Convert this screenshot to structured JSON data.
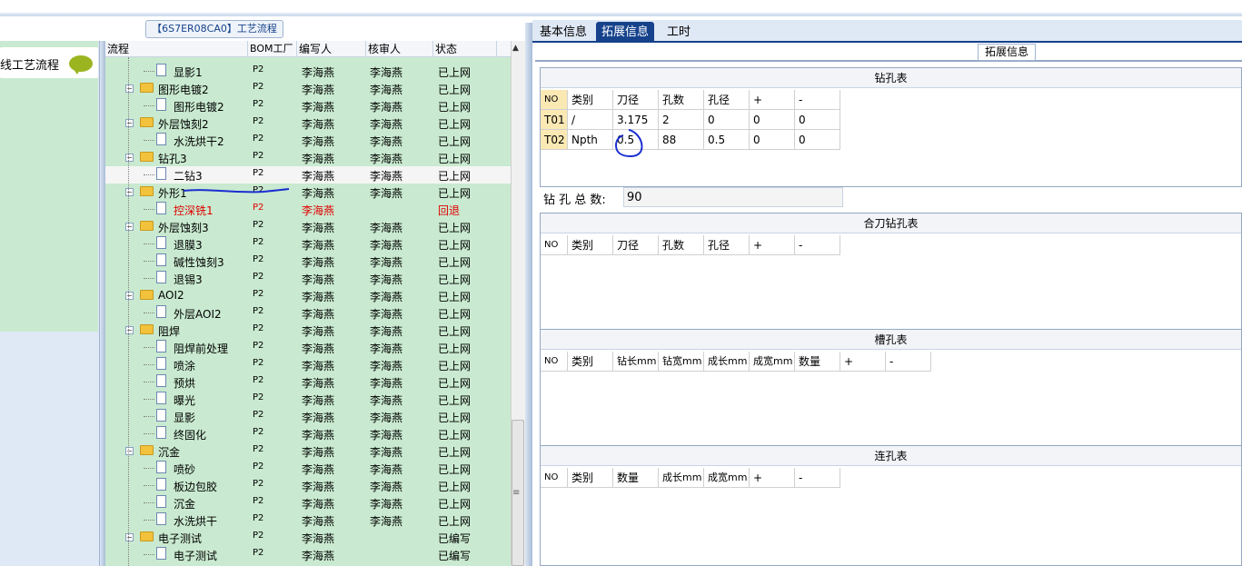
{
  "tree_title": "【6S7ER08CA0】工艺流程",
  "left_nav": {
    "item": "线工艺流程",
    "icon": "speech-bubble-icon"
  },
  "tree": {
    "columns": [
      "流程",
      "BOM工厂",
      "编写人",
      "核审人",
      "状态"
    ],
    "rows": [
      {
        "level": 2,
        "type": "doc",
        "name": "显影1",
        "bom": "P2",
        "writer": "李海燕",
        "reviewer": "李海燕",
        "status": "已上网"
      },
      {
        "level": 1,
        "type": "folder",
        "name": "图形电镀2",
        "bom": "P2",
        "writer": "李海燕",
        "reviewer": "李海燕",
        "status": "已上网"
      },
      {
        "level": 2,
        "type": "doc",
        "name": "图形电镀2",
        "bom": "P2",
        "writer": "李海燕",
        "reviewer": "李海燕",
        "status": "已上网"
      },
      {
        "level": 1,
        "type": "folder",
        "name": "外层蚀刻2",
        "bom": "P2",
        "writer": "李海燕",
        "reviewer": "李海燕",
        "status": "已上网"
      },
      {
        "level": 2,
        "type": "doc",
        "name": "水洗烘干2",
        "bom": "P2",
        "writer": "李海燕",
        "reviewer": "李海燕",
        "status": "已上网"
      },
      {
        "level": 1,
        "type": "folder",
        "name": "钻孔3",
        "bom": "P2",
        "writer": "李海燕",
        "reviewer": "李海燕",
        "status": "已上网"
      },
      {
        "level": 2,
        "type": "doc",
        "name": "二钻3",
        "bom": "P2",
        "writer": "李海燕",
        "reviewer": "李海燕",
        "status": "已上网",
        "selected": true
      },
      {
        "level": 1,
        "type": "folder",
        "name": "外形1",
        "bom": "P2",
        "writer": "李海燕",
        "reviewer": "李海燕",
        "status": "已上网"
      },
      {
        "level": 2,
        "type": "doc",
        "name": "控深铣1",
        "bom": "P2",
        "writer": "李海燕",
        "reviewer": "",
        "status": "回退",
        "red": true
      },
      {
        "level": 1,
        "type": "folder",
        "name": "外层蚀刻3",
        "bom": "P2",
        "writer": "李海燕",
        "reviewer": "李海燕",
        "status": "已上网"
      },
      {
        "level": 2,
        "type": "doc",
        "name": "退膜3",
        "bom": "P2",
        "writer": "李海燕",
        "reviewer": "李海燕",
        "status": "已上网"
      },
      {
        "level": 2,
        "type": "doc",
        "name": "碱性蚀刻3",
        "bom": "P2",
        "writer": "李海燕",
        "reviewer": "李海燕",
        "status": "已上网"
      },
      {
        "level": 2,
        "type": "doc",
        "name": "退锡3",
        "bom": "P2",
        "writer": "李海燕",
        "reviewer": "李海燕",
        "status": "已上网"
      },
      {
        "level": 1,
        "type": "folder",
        "name": "AOI2",
        "bom": "P2",
        "writer": "李海燕",
        "reviewer": "李海燕",
        "status": "已上网"
      },
      {
        "level": 2,
        "type": "doc",
        "name": "外层AOI2",
        "bom": "P2",
        "writer": "李海燕",
        "reviewer": "李海燕",
        "status": "已上网"
      },
      {
        "level": 1,
        "type": "folder",
        "name": "阻焊",
        "bom": "P2",
        "writer": "李海燕",
        "reviewer": "李海燕",
        "status": "已上网"
      },
      {
        "level": 2,
        "type": "doc",
        "name": "阻焊前处理",
        "bom": "P2",
        "writer": "李海燕",
        "reviewer": "李海燕",
        "status": "已上网"
      },
      {
        "level": 2,
        "type": "doc",
        "name": "喷涂",
        "bom": "P2",
        "writer": "李海燕",
        "reviewer": "李海燕",
        "status": "已上网"
      },
      {
        "level": 2,
        "type": "doc",
        "name": "预烘",
        "bom": "P2",
        "writer": "李海燕",
        "reviewer": "李海燕",
        "status": "已上网"
      },
      {
        "level": 2,
        "type": "doc",
        "name": "曝光",
        "bom": "P2",
        "writer": "李海燕",
        "reviewer": "李海燕",
        "status": "已上网"
      },
      {
        "level": 2,
        "type": "doc",
        "name": "显影",
        "bom": "P2",
        "writer": "李海燕",
        "reviewer": "李海燕",
        "status": "已上网"
      },
      {
        "level": 2,
        "type": "doc",
        "name": "终固化",
        "bom": "P2",
        "writer": "李海燕",
        "reviewer": "李海燕",
        "status": "已上网"
      },
      {
        "level": 1,
        "type": "folder",
        "name": "沉金",
        "bom": "P2",
        "writer": "李海燕",
        "reviewer": "李海燕",
        "status": "已上网"
      },
      {
        "level": 2,
        "type": "doc",
        "name": "喷砂",
        "bom": "P2",
        "writer": "李海燕",
        "reviewer": "李海燕",
        "status": "已上网"
      },
      {
        "level": 2,
        "type": "doc",
        "name": "板边包胶",
        "bom": "P2",
        "writer": "李海燕",
        "reviewer": "李海燕",
        "status": "已上网"
      },
      {
        "level": 2,
        "type": "doc",
        "name": "沉金",
        "bom": "P2",
        "writer": "李海燕",
        "reviewer": "李海燕",
        "status": "已上网"
      },
      {
        "level": 2,
        "type": "doc",
        "name": "水洗烘干",
        "bom": "P2",
        "writer": "李海燕",
        "reviewer": "李海燕",
        "status": "已上网"
      },
      {
        "level": 1,
        "type": "folder",
        "name": "电子测试",
        "bom": "P2",
        "writer": "李海燕",
        "reviewer": "",
        "status": "已编写"
      },
      {
        "level": 2,
        "type": "doc",
        "name": "电子测试",
        "bom": "P2",
        "writer": "李海燕",
        "reviewer": "",
        "status": "已编写"
      }
    ]
  },
  "tabs": [
    "基本信息",
    "拓展信息",
    "工时"
  ],
  "active_tab": "拓展信息",
  "panel_title": "拓展信息",
  "drill_table": {
    "title": "钻孔表",
    "headers": [
      "NO",
      "类别",
      "刀径",
      "孔数",
      "孔径",
      "+",
      "-"
    ],
    "rows": [
      [
        "T01",
        "/",
        "3.175",
        "2",
        "0",
        "0",
        "0"
      ],
      [
        "T02",
        "Npth",
        "0.5",
        "88",
        "0.5",
        "0",
        "0"
      ]
    ]
  },
  "drill_total": {
    "label": "钻 孔 总 数:",
    "value": "90"
  },
  "combined_table": {
    "title": "合刀钻孔表",
    "headers": [
      "NO",
      "类别",
      "刀径",
      "孔数",
      "孔径",
      "+",
      "-"
    ]
  },
  "slot_table": {
    "title": "槽孔表",
    "headers": [
      "NO",
      "类别",
      "钻长mm",
      "钻宽mm",
      "成长mm",
      "成宽mm",
      "数量",
      "+",
      "-"
    ]
  },
  "link_table": {
    "title": "连孔表",
    "headers": [
      "NO",
      "类别",
      "数量",
      "成长mm",
      "成宽mm",
      "+",
      "-"
    ]
  },
  "colors": {
    "tab_active": "#15428b",
    "tree_bg": "#c9ead0",
    "revert": "#e00000",
    "pen": "#1a2fd0"
  }
}
